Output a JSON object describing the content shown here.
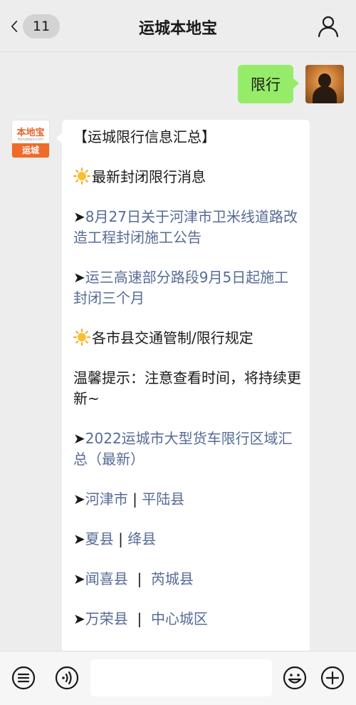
{
  "header": {
    "back_count": "11",
    "title": "运城本地宝"
  },
  "outgoing": {
    "text": "限行"
  },
  "bot_avatar": {
    "logo_top": "本地宝",
    "logo_sub": "Bendibao.com",
    "logo_city": "运城"
  },
  "message": {
    "title": "【运城限行信息汇总】",
    "section1": "最新封闭限行消息",
    "link1": "8月27日关于河津市卫米线道路改造工程封闭施工公告",
    "link2": "运三高速部分路段9月5日起施工封闭三个月",
    "section2": "各市县交通管制/限行规定",
    "tip": "温馨提示：注意查看时间，将持续更新~",
    "link3": "2022运城市大型货车限行区域汇总（最新）",
    "county_rows": [
      {
        "a": "河津市",
        "sep": " | ",
        "b": "平陆县"
      },
      {
        "a": "夏县",
        "sep": " | ",
        "b": "绛县"
      },
      {
        "a": "闻喜县",
        "sep": "  |  ",
        "b": "芮城县"
      },
      {
        "a": "万荣县",
        "sep": "  |  ",
        "b": "中心城区"
      }
    ]
  },
  "colors": {
    "link": "#576b95",
    "bubble_out": "#95ec69",
    "background": "#ededed"
  }
}
